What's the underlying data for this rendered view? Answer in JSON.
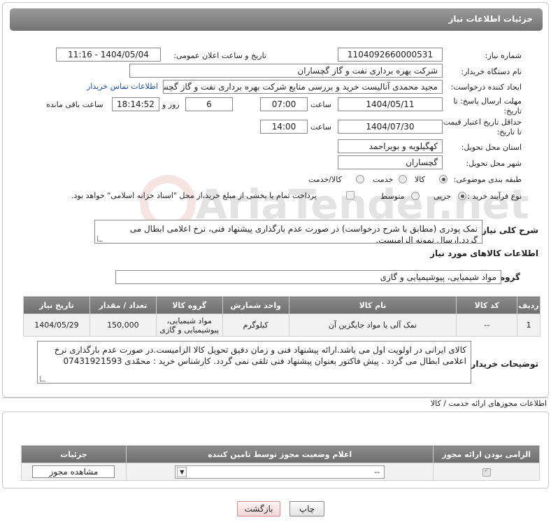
{
  "header": {
    "title": "جزئیات اطلاعات نیاز"
  },
  "form": {
    "need_number_label": "شماره نیاز:",
    "need_number": "1104092660000531",
    "announce_label": "تاریخ و ساعت اعلان عمومی:",
    "announce_value": "1404/05/04 - 11:16",
    "buyer_org_label": "نام دستگاه خریدار:",
    "buyer_org": "شرکت بهره برداری نفت و گاز گچساران",
    "requester_label": "ایجاد کننده درخواست:",
    "requester": "مجید محمدی آنالیست خرید و بررسی منابع شرکت بهره برداری نفت و گاز گچساران",
    "contact_link": "اطلاعات تماس خریدار",
    "deadline_label_1": "مهلت ارسال پاسخ: تا",
    "deadline_label_2": "تاریخ:",
    "deadline_date": "1404/05/11",
    "time_label": "ساعت",
    "deadline_time": "07:00",
    "days_value": "6",
    "days_label": "روز و",
    "remaining_time": "18:14:52",
    "remaining_label": "ساعت باقی مانده",
    "validity_label_1": "حداقل تاریخ اعتبار قیمت:",
    "validity_label_2": "تا تاریخ:",
    "validity_date": "1404/07/30",
    "validity_time_label": "ساعت",
    "validity_time": "14:00",
    "province_label": "استان محل تحویل:",
    "province": "کهگیلویه و بویراحمد",
    "city_label": "شهر محل تحویل:",
    "city": "گچساران",
    "category_label": "طبقه بندی موضوعی:",
    "category_options": [
      "کالا",
      "خدمت",
      "کالا/خدمت"
    ],
    "purchase_type_label": "نوع فرآیند خرید :",
    "purchase_options": [
      "جزیی",
      "متوسط"
    ],
    "purchase_note": "پرداخت تمام یا بخشی از مبلغ خرید،از محل \"اسناد خزانه اسلامی\" خواهد بود."
  },
  "description": {
    "label": "شرح کلی نیاز:",
    "text": "نمک پودری  (مطابق با شرح درخواست) در صورت عدم بارگذاری پیشنهاد فنی، نرخ اعلامی ابطال می گردد.ارسال نمونه الزامیست."
  },
  "goods": {
    "section_title": "اطلاعات کالاهای مورد نیاز",
    "group_label": "گروه کالا:",
    "group_value": "مواد شیمیایی، پیوشیمیایی و  گازی",
    "columns": [
      "ردیف",
      "کد کالا",
      "نام کالا",
      "واحد شمارش",
      "گروه کالا",
      "تعداد / مقدار",
      "تاریخ نیاز"
    ],
    "rows": [
      {
        "row": "1",
        "code": "--",
        "name": "نمک آلی یا مواد جایگزین آن",
        "unit": "کیلوگرم",
        "group_line1": "مواد شیمیایی،",
        "group_line2": "پیوشیمیایی و گازی",
        "qty": "150,000",
        "date": "1404/05/29"
      }
    ]
  },
  "buyer_notes": {
    "label": "توضیحات خریدار:",
    "text": "کالای ایرانی در اولویت اول می باشد.ارائه پیشنهاد فنی و زمان دقیق تحویل کالا الزامیست.در صورت عدم بارگذاری نرخ اعلامی ابطال می گردد . پیش فاکتور بعنوان پیشنهاد  فنی تلقی نمی گردد. کارشناس خرید : محمّدی  07431921593"
  },
  "permits": {
    "section_title": "اطلاعات مجوزهای ارائه خدمت / کالا",
    "columns": [
      "الزامی بودن ارائه مجوز",
      "اعلام وضعیت مجوز توسط تامین کننده",
      "جزئیات"
    ],
    "select_value": "--",
    "view_button": "مشاهده مجوز"
  },
  "actions": {
    "print": "چاپ",
    "back": "بازگشت"
  },
  "watermark": {
    "text": "AriaTender.net"
  }
}
